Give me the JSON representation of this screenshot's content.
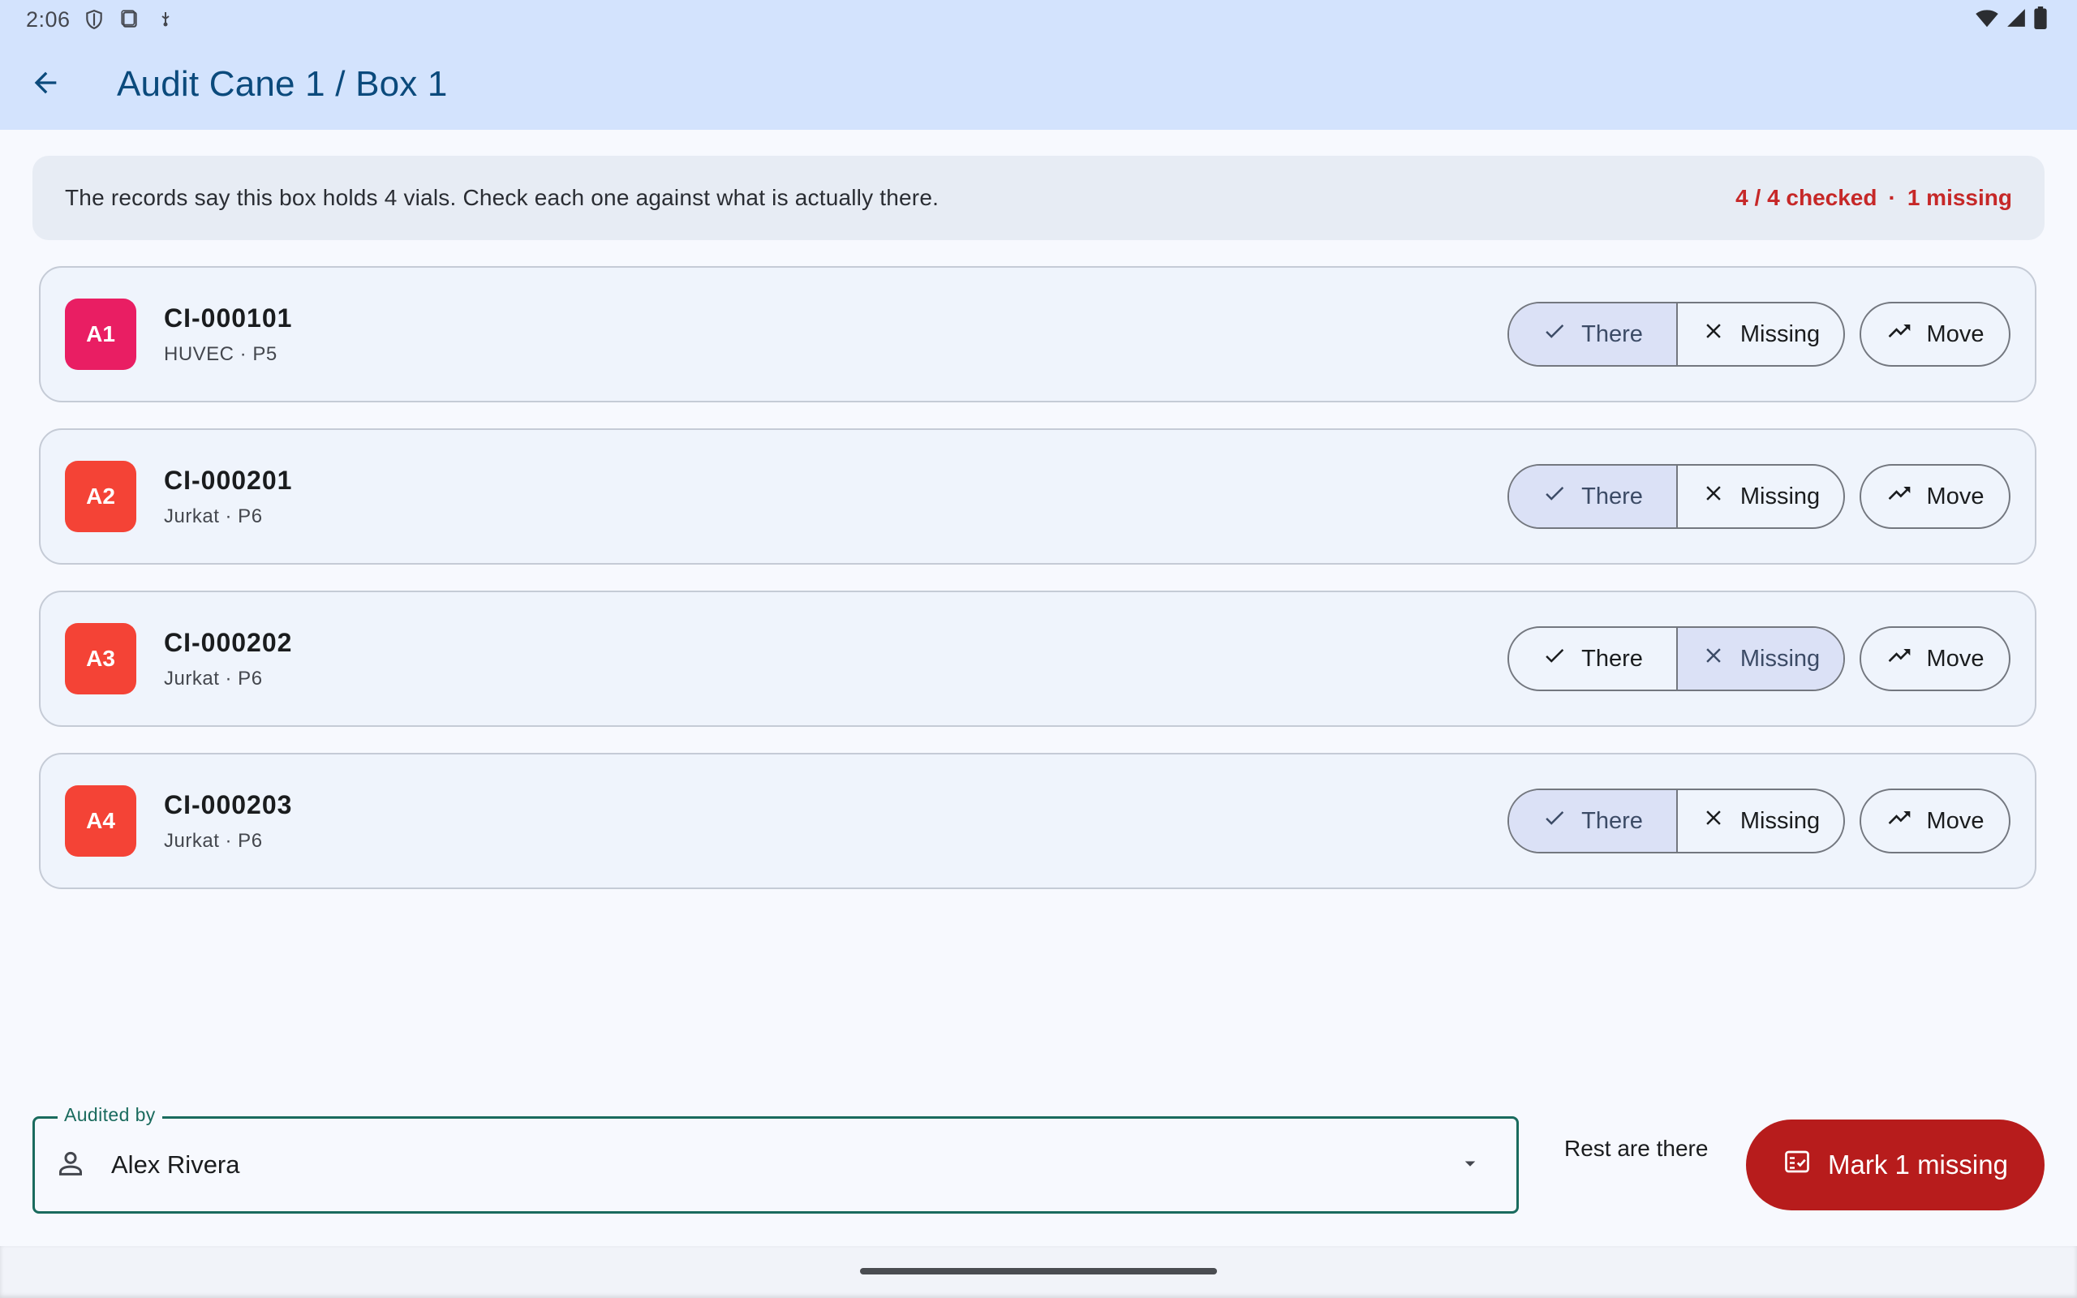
{
  "status_bar": {
    "time": "2:06"
  },
  "app_bar": {
    "title": "Audit Cane 1 / Box 1"
  },
  "summary": {
    "message": "The records say this box holds 4 vials. Check each one against what is actually there.",
    "checked": "4 / 4 checked",
    "separator": "·",
    "missing": "1 missing",
    "accent_color": "#c62828"
  },
  "labels": {
    "there": "There",
    "missing": "Missing",
    "move": "Move"
  },
  "vials": [
    {
      "position": "A1",
      "id": "CI-000101",
      "subtitle": "HUVEC · P5",
      "badge_color": "#e91e63",
      "status": "there"
    },
    {
      "position": "A2",
      "id": "CI-000201",
      "subtitle": "Jurkat · P6",
      "badge_color": "#f44336",
      "status": "there"
    },
    {
      "position": "A3",
      "id": "CI-000202",
      "subtitle": "Jurkat · P6",
      "badge_color": "#f44336",
      "status": "missing"
    },
    {
      "position": "A4",
      "id": "CI-000203",
      "subtitle": "Jurkat · P6",
      "badge_color": "#f44336",
      "status": "there"
    }
  ],
  "bottom": {
    "audited_by_label": "Audited by",
    "auditor": "Alex Rivera",
    "rest_button": "Rest are there",
    "mark_button": "Mark 1 missing",
    "mark_button_color": "#b71c1c"
  }
}
